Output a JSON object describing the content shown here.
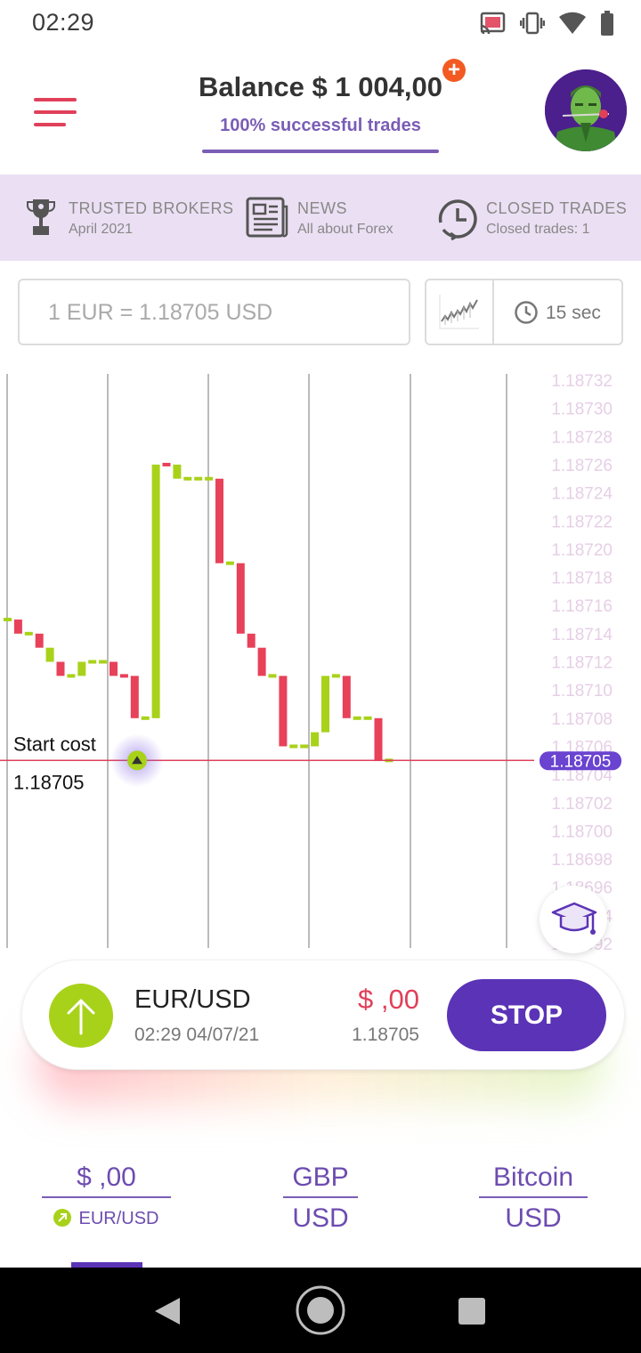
{
  "status_bar": {
    "time": "02:29",
    "icons": [
      "cast-icon",
      "vibrate-icon",
      "wifi-icon",
      "battery-icon"
    ]
  },
  "header": {
    "balance": "Balance $ 1 004,00",
    "success_label": "100% successful trades",
    "add_funds_icon": "plus-icon"
  },
  "info_strip": {
    "items": [
      {
        "title": "TRUSTED BROKERS",
        "subtitle": "April 2021",
        "icon": "trophy-icon"
      },
      {
        "title": "NEWS",
        "subtitle": "All about Forex",
        "icon": "newspaper-icon"
      },
      {
        "title": "CLOSED TRADES",
        "subtitle": "Closed trades: 1",
        "icon": "history-clock-icon"
      }
    ]
  },
  "controls": {
    "rate": "1 EUR = 1.18705  USD",
    "timer": "15 sec"
  },
  "chart_data": {
    "type": "line",
    "title": "",
    "y_ticks": [
      "1.18732",
      "1.18730",
      "1.18728",
      "1.18726",
      "1.18724",
      "1.18722",
      "1.18720",
      "1.18718",
      "1.18716",
      "1.18714",
      "1.18712",
      "1.18710",
      "1.18708",
      "1.18706",
      "1.18704",
      "1.18702",
      "1.18700",
      "1.18698",
      "1.18696",
      "1.18694",
      "1.18692"
    ],
    "ylim": [
      1.18692,
      1.18732
    ],
    "current_price": "1.18705",
    "start_cost_label": "Start cost",
    "start_cost_value": "1.18705",
    "steps": [
      {
        "v": 1.18715,
        "d": "up"
      },
      {
        "v": 1.18714,
        "d": "down"
      },
      {
        "v": 1.18714,
        "d": "up"
      },
      {
        "v": 1.18713,
        "d": "down"
      },
      {
        "v": 1.18712,
        "d": "up"
      },
      {
        "v": 1.18711,
        "d": "down"
      },
      {
        "v": 1.18711,
        "d": "up"
      },
      {
        "v": 1.18712,
        "d": "up"
      },
      {
        "v": 1.18712,
        "d": "up"
      },
      {
        "v": 1.18712,
        "d": "up"
      },
      {
        "v": 1.18711,
        "d": "down"
      },
      {
        "v": 1.18711,
        "d": "down"
      },
      {
        "v": 1.18708,
        "d": "down"
      },
      {
        "v": 1.18708,
        "d": "up"
      },
      {
        "v": 1.18726,
        "d": "up"
      },
      {
        "v": 1.18726,
        "d": "down"
      },
      {
        "v": 1.18725,
        "d": "up"
      },
      {
        "v": 1.18725,
        "d": "up"
      },
      {
        "v": 1.18725,
        "d": "up"
      },
      {
        "v": 1.18725,
        "d": "up"
      },
      {
        "v": 1.18719,
        "d": "down"
      },
      {
        "v": 1.18719,
        "d": "up"
      },
      {
        "v": 1.18714,
        "d": "down"
      },
      {
        "v": 1.18713,
        "d": "down"
      },
      {
        "v": 1.18711,
        "d": "down"
      },
      {
        "v": 1.18711,
        "d": "up"
      },
      {
        "v": 1.18706,
        "d": "down"
      },
      {
        "v": 1.18706,
        "d": "up"
      },
      {
        "v": 1.18706,
        "d": "up"
      },
      {
        "v": 1.18707,
        "d": "up"
      },
      {
        "v": 1.18711,
        "d": "up"
      },
      {
        "v": 1.18711,
        "d": "up"
      },
      {
        "v": 1.18708,
        "d": "down"
      },
      {
        "v": 1.18708,
        "d": "up"
      },
      {
        "v": 1.18708,
        "d": "up"
      },
      {
        "v": 1.18705,
        "d": "down"
      },
      {
        "v": 1.18705,
        "d": "up"
      }
    ],
    "colors": {
      "up": "#a8d21a",
      "down": "#e8415a",
      "start_line": "#e0405a",
      "price_badge": "#6a43d0",
      "tick": "#e6cfe6"
    }
  },
  "trade": {
    "pair": "EUR/USD",
    "time": "02:29 04/07/21",
    "profit": "$ ,00",
    "price": "1.18705",
    "stop_label": "STOP",
    "direction_icon": "arrow-up-icon"
  },
  "assets": [
    {
      "top": "$ ,00",
      "bottom": "EUR/USD",
      "icon": "arrow-up-right-icon"
    },
    {
      "top": "GBP",
      "bottom": "USD"
    },
    {
      "top": "Bitcoin",
      "bottom": "USD"
    }
  ],
  "colors": {
    "accent": "#5b33b6",
    "brand_red": "#e0405a",
    "strip_bg": "#ebe0f3"
  }
}
